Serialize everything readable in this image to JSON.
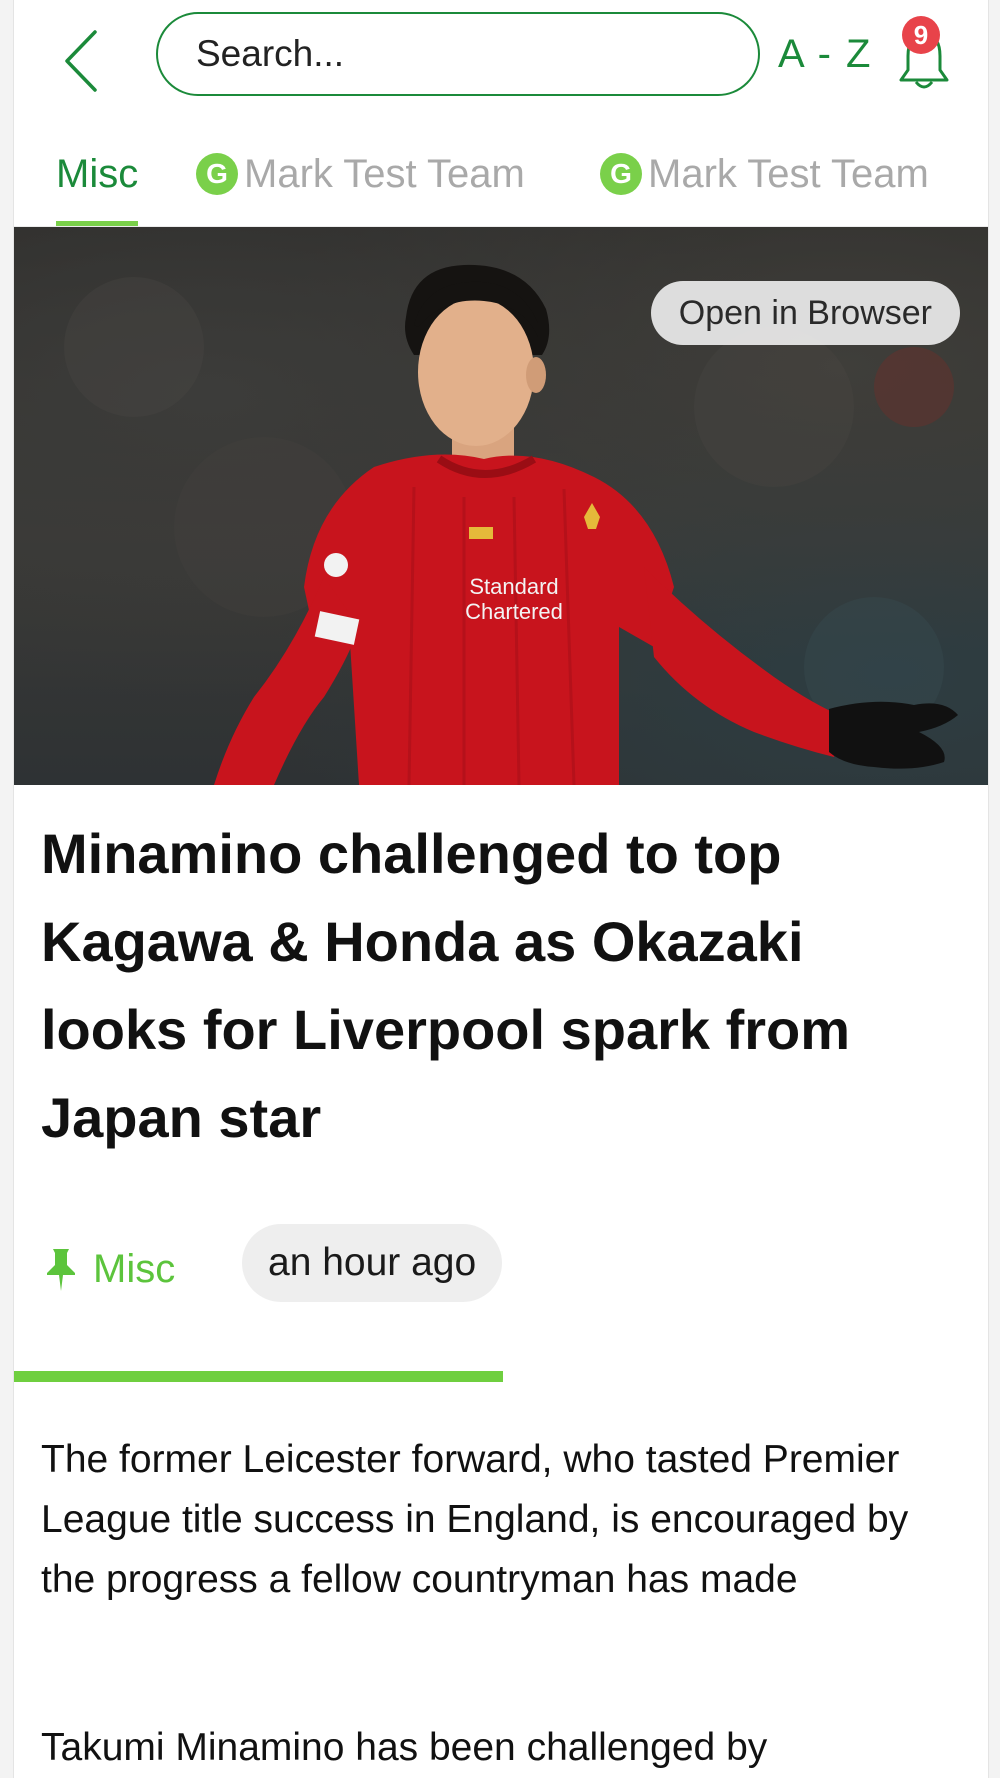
{
  "header": {
    "search_placeholder": "Search...",
    "az_label": "A - Z",
    "notification_count": "9"
  },
  "tabs": [
    {
      "label": "Misc",
      "active": true,
      "has_icon": false
    },
    {
      "label": "Mark Test Team",
      "active": false,
      "has_icon": true,
      "icon_letter": "G"
    },
    {
      "label": "Mark Test Team",
      "active": false,
      "has_icon": true,
      "icon_letter": "G"
    }
  ],
  "hero": {
    "open_in_browser_label": "Open in Browser",
    "shirt_sponsor_line1": "Standard",
    "shirt_sponsor_line2": "Chartered"
  },
  "article": {
    "title": "Minamino challenged to top Kagawa & Honda as Okazaki looks for Liverpool spark from Japan star",
    "category": "Misc",
    "time_ago": "an hour ago",
    "paragraphs": [
      "The former Leicester forward, who tasted Premier League title success in England, is encouraged by the progress a fellow countryman has made",
      "Takumi Minamino has been challenged by"
    ]
  },
  "colors": {
    "brand_green": "#1b8a3a",
    "accent_green": "#7ad04a",
    "badge_red": "#e8434a"
  }
}
